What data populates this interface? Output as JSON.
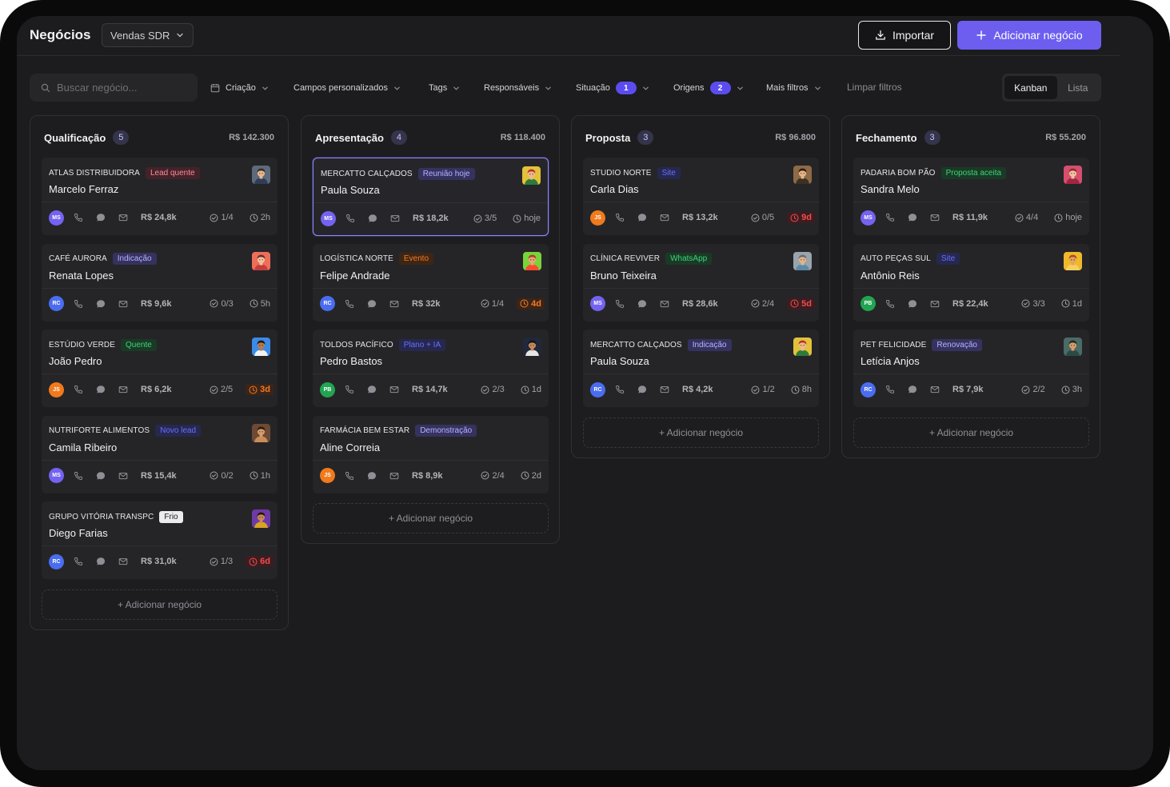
{
  "header": {
    "title": "Negócios",
    "pipeline": "Vendas SDR",
    "import_label": "Importar",
    "add_label": "Adicionar negócio"
  },
  "filters": {
    "search_placeholder": "Buscar negócio...",
    "items": [
      {
        "label": "Criação"
      },
      {
        "label": "Campos personalizados"
      },
      {
        "label": "Tags"
      },
      {
        "label": "Responsáveis"
      },
      {
        "label": "Situação",
        "badge": "1"
      },
      {
        "label": "Origens",
        "badge": "2"
      },
      {
        "label": "Mais filtros"
      }
    ],
    "clear_label": "Limpar filtros",
    "views": [
      "Kanban",
      "Lista"
    ],
    "active_view": "Kanban"
  },
  "colors": {
    "accent": "#6d5ef0",
    "tags": {
      "red": {
        "bg": "#43232a",
        "fg": "#ff8a96"
      },
      "purple": {
        "bg": "#35325f",
        "fg": "#b8b2ff"
      },
      "green": {
        "bg": "#1a3a26",
        "fg": "#3dd47a"
      },
      "blue": {
        "bg": "#26284f",
        "fg": "#6670ff"
      },
      "orange": {
        "bg": "#3e2614",
        "fg": "#f47b25"
      },
      "white": {
        "bg": "#ececee",
        "fg": "#1d1d20"
      }
    },
    "owners": {
      "MS": "#7463f0",
      "RC": "#4a6df0",
      "JS": "#f07a1c",
      "PB": "#22a552"
    }
  },
  "add_card_label": "+ Adicionar negócio",
  "columns": [
    {
      "title": "Qualificação",
      "count": "5",
      "total": "R$ 142.300",
      "cards": [
        {
          "company": "ATLAS DISTRIBUIDORA",
          "tag": "Lead quente",
          "tag_color": "red",
          "contact": "Marcelo Ferraz",
          "owner": "MS",
          "value": "R$ 24,8k",
          "tasks": "1/4",
          "time": "2h",
          "time_state": "normal",
          "avatar": "slate"
        },
        {
          "company": "CAFÉ AURORA",
          "tag": "Indicação",
          "tag_color": "purple",
          "contact": "Renata Lopes",
          "owner": "RC",
          "value": "R$ 9,6k",
          "tasks": "0/3",
          "time": "5h",
          "time_state": "normal",
          "avatar": "coral"
        },
        {
          "company": "ESTÚDIO VERDE",
          "tag": "Quente",
          "tag_color": "green",
          "contact": "João Pedro",
          "owner": "JS",
          "value": "R$ 6,2k",
          "tasks": "2/5",
          "time": "3d",
          "time_state": "warn",
          "avatar": "sky"
        },
        {
          "company": "NUTRIFORTE ALIMENTOS",
          "tag": "Novo lead",
          "tag_color": "blue",
          "contact": "Camila Ribeiro",
          "owner": "MS",
          "value": "R$ 15,4k",
          "tasks": "0/2",
          "time": "1h",
          "time_state": "normal",
          "avatar": "brown"
        },
        {
          "company": "GRUPO VITÓRIA TRANSPC",
          "tag": "Frio",
          "tag_color": "white",
          "contact": "Diego Farias",
          "owner": "RC",
          "value": "R$ 31,0k",
          "tasks": "1/3",
          "time": "6d",
          "time_state": "danger",
          "avatar": "violet"
        }
      ]
    },
    {
      "title": "Apresentação",
      "count": "4",
      "total": "R$ 118.400",
      "cards": [
        {
          "company": "MERCATTO CALÇADOS",
          "tag": "Reunião hoje",
          "tag_color": "purple",
          "contact": "Paula Souza",
          "owner": "MS",
          "value": "R$ 18,2k",
          "tasks": "3/5",
          "time": "hoje",
          "time_state": "normal",
          "avatar": "yellow",
          "selected": true
        },
        {
          "company": "LOGÍSTICA NORTE",
          "tag": "Evento",
          "tag_color": "orange",
          "contact": "Felipe Andrade",
          "owner": "RC",
          "value": "R$ 32k",
          "tasks": "1/4",
          "time": "4d",
          "time_state": "warn",
          "avatar": "lime"
        },
        {
          "company": "TOLDOS PACÍFICO",
          "tag": "Plano + IA",
          "tag_color": "blue",
          "contact": "Pedro Bastos",
          "owner": "PB",
          "value": "R$ 14,7k",
          "tasks": "2/3",
          "time": "1d",
          "time_state": "normal",
          "avatar": "navy"
        },
        {
          "company": "FARMÁCIA BEM ESTAR",
          "tag": "Demonstração",
          "tag_color": "purple",
          "contact": "Aline Correia",
          "owner": "JS",
          "value": "R$ 8,9k",
          "tasks": "2/4",
          "time": "2d",
          "time_state": "normal",
          "avatar": "none"
        }
      ]
    },
    {
      "title": "Proposta",
      "count": "3",
      "total": "R$ 96.800",
      "cards": [
        {
          "company": "STUDIO NORTE",
          "tag": "Site",
          "tag_color": "blue",
          "contact": "Carla Dias",
          "owner": "JS",
          "value": "R$ 13,2k",
          "tasks": "0/5",
          "time": "9d",
          "time_state": "danger",
          "avatar": "tan"
        },
        {
          "company": "CLÍNICA REVIVER",
          "tag": "WhatsApp",
          "tag_color": "green",
          "contact": "Bruno Teixeira",
          "owner": "MS",
          "value": "R$ 28,6k",
          "tasks": "2/4",
          "time": "5d",
          "time_state": "danger",
          "avatar": "gray"
        },
        {
          "company": "MERCATTO CALÇADOS",
          "tag": "Indicação",
          "tag_color": "purple",
          "contact": "Paula Souza",
          "owner": "RC",
          "value": "R$ 4,2k",
          "tasks": "1/2",
          "time": "8h",
          "time_state": "normal",
          "avatar": "yellow"
        }
      ]
    },
    {
      "title": "Fechamento",
      "count": "3",
      "total": "R$ 55.200",
      "cards": [
        {
          "company": "PADARIA BOM PÃO",
          "tag": "Proposta aceita",
          "tag_color": "green",
          "contact": "Sandra Melo",
          "owner": "MS",
          "value": "R$ 11,9k",
          "tasks": "4/4",
          "time": "hoje",
          "time_state": "normal",
          "avatar": "rose"
        },
        {
          "company": "AUTO PEÇAS SUL",
          "tag": "Site",
          "tag_color": "blue",
          "contact": "Antônio Reis",
          "owner": "PB",
          "value": "R$ 22,4k",
          "tasks": "3/3",
          "time": "1d",
          "time_state": "normal",
          "avatar": "gold"
        },
        {
          "company": "PET FELICIDADE",
          "tag": "Renovação",
          "tag_color": "purple",
          "contact": "Letícia Anjos",
          "owner": "RC",
          "value": "R$ 7,9k",
          "tasks": "2/2",
          "time": "3h",
          "time_state": "normal",
          "avatar": "teal"
        }
      ]
    }
  ]
}
